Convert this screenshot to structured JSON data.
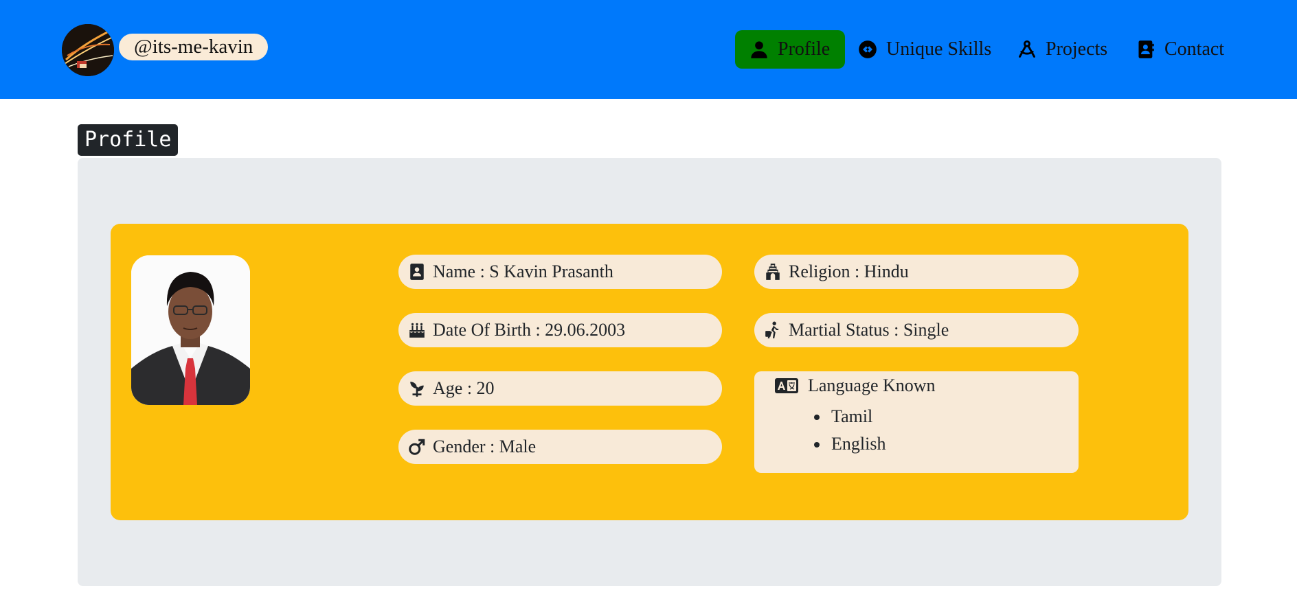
{
  "header": {
    "handle": "@its-me-kavin",
    "nav": [
      {
        "label": "Profile",
        "icon": "person-icon",
        "active": true
      },
      {
        "label": "Unique Skills",
        "icon": "skills-icon",
        "active": false
      },
      {
        "label": "Projects",
        "icon": "compass-drafting-icon",
        "active": false
      },
      {
        "label": "Contact",
        "icon": "address-book-icon",
        "active": false
      }
    ]
  },
  "section": {
    "title": "Profile"
  },
  "details": {
    "name": "Name : S Kavin Prasanth",
    "dob": "Date Of Birth : 29.06.2003",
    "age": "Age : 20",
    "gender": "Gender : Male",
    "religion": "Religion : Hindu",
    "marital": "Martial Status : Single",
    "languages_title": "Language Known",
    "languages": [
      "Tamil",
      "English"
    ]
  },
  "colors": {
    "navbar": "#0079fb",
    "active_nav": "#008000",
    "card": "#fdc00c",
    "panel": "#e8ebee",
    "pill": "#f8ead8"
  }
}
